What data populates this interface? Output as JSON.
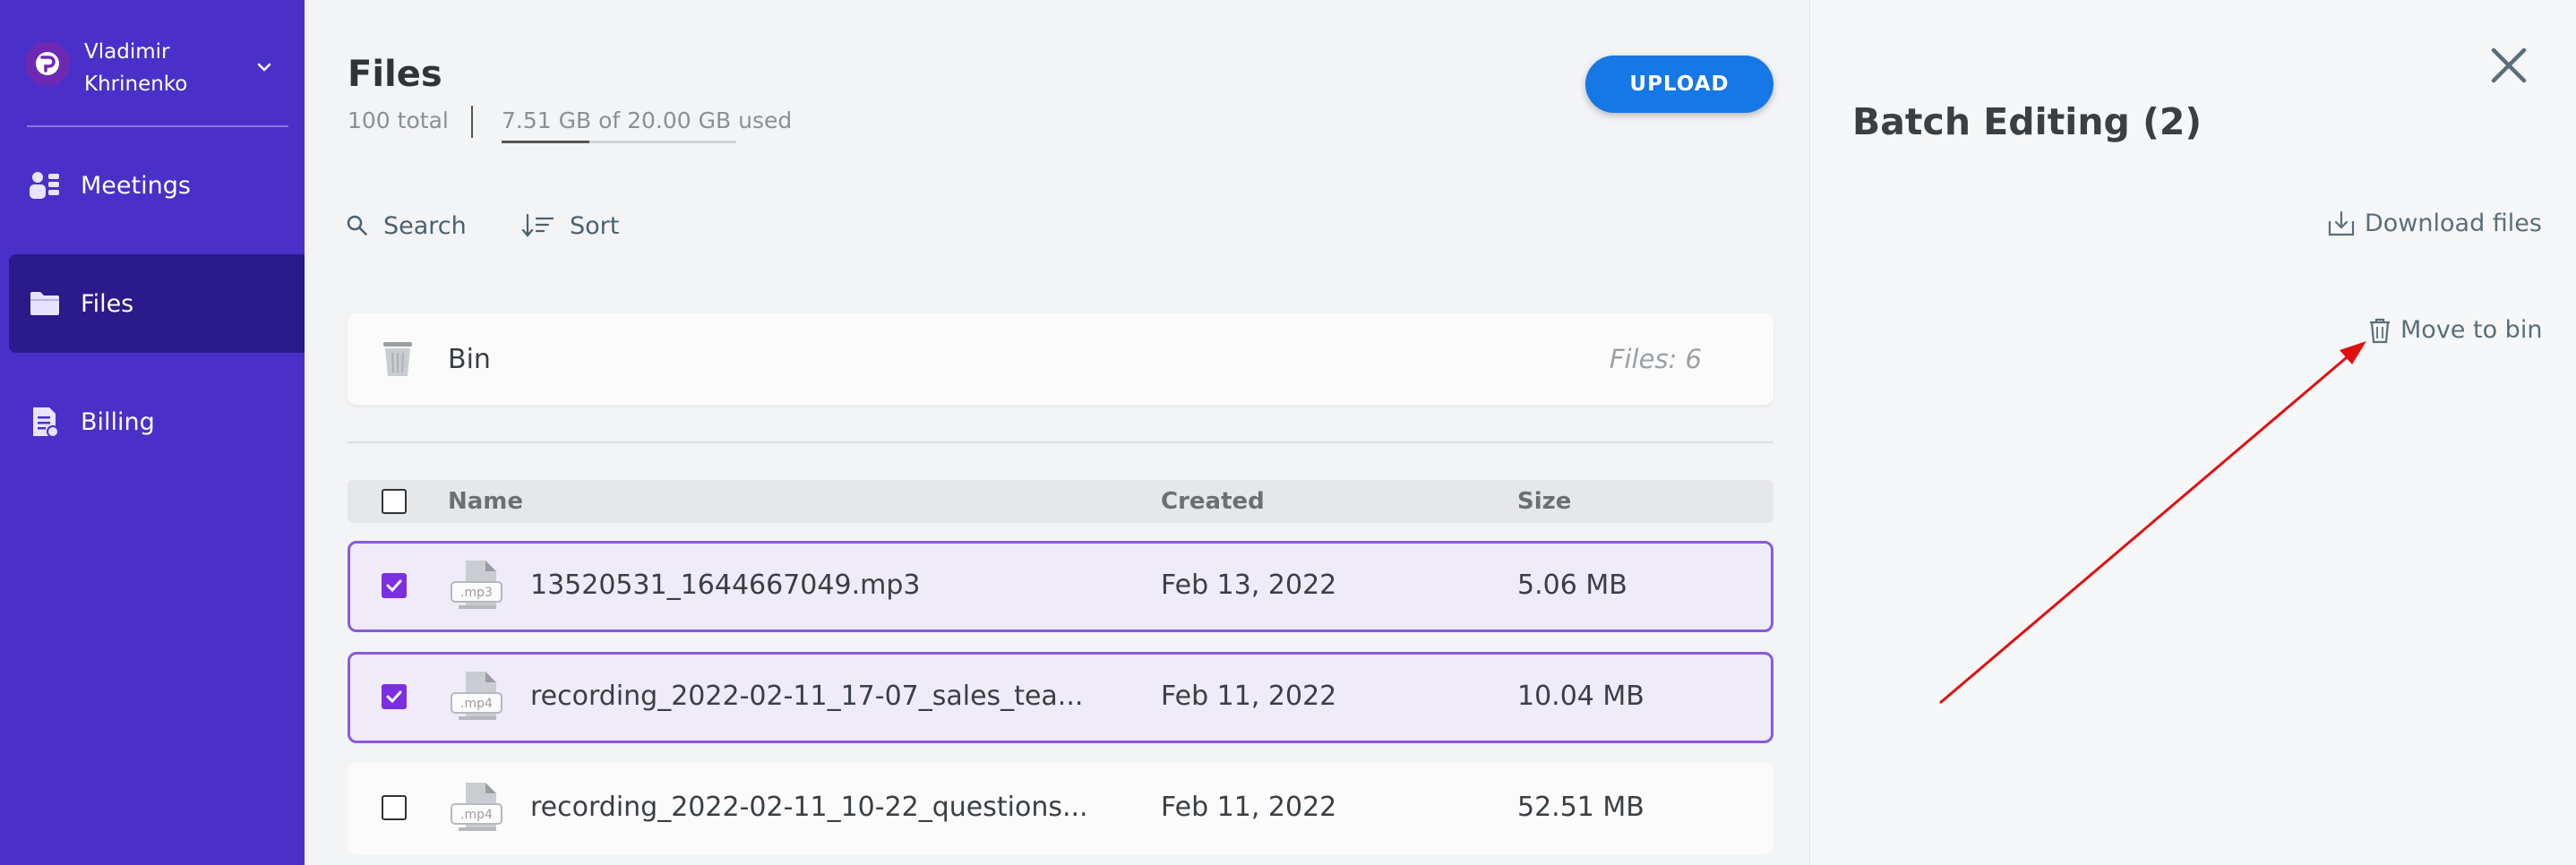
{
  "user": {
    "name_line1": "Vladimir",
    "name_line2": "Khrinenko"
  },
  "nav": [
    {
      "label": "Meetings"
    },
    {
      "label": "Files"
    },
    {
      "label": "Billing"
    }
  ],
  "header": {
    "title": "Files",
    "total": "100 total",
    "storage": "7.51 GB of 20.00 GB used",
    "storage_used_fraction": 0.3755,
    "upload_label": "UPLOAD"
  },
  "toolbar": {
    "search_label": "Search",
    "sort_label": "Sort"
  },
  "bin": {
    "label": "Bin",
    "count": "Files: 6"
  },
  "table": {
    "columns": [
      "Name",
      "Created",
      "Size"
    ],
    "rows": [
      {
        "name": "13520531_1644667049.mp3",
        "ext": ".mp3",
        "created": "Feb 13, 2022",
        "size": "5.06 MB",
        "checked": true
      },
      {
        "name": "recording_2022-02-11_17-07_sales_tea...",
        "ext": ".mp4",
        "created": "Feb 11, 2022",
        "size": "10.04 MB",
        "checked": true
      },
      {
        "name": "recording_2022-02-11_10-22_questions...",
        "ext": ".mp4",
        "created": "Feb 11, 2022",
        "size": "52.51 MB",
        "checked": false
      }
    ]
  },
  "panel": {
    "title": "Batch Editing (2)",
    "download_label": "Download files",
    "move_label": "Move to bin"
  },
  "colors": {
    "sidebar": "#4a2fc9",
    "accent": "#1677e6",
    "selection": "#8a5ae0",
    "annotation_arrow": "#e01010"
  }
}
